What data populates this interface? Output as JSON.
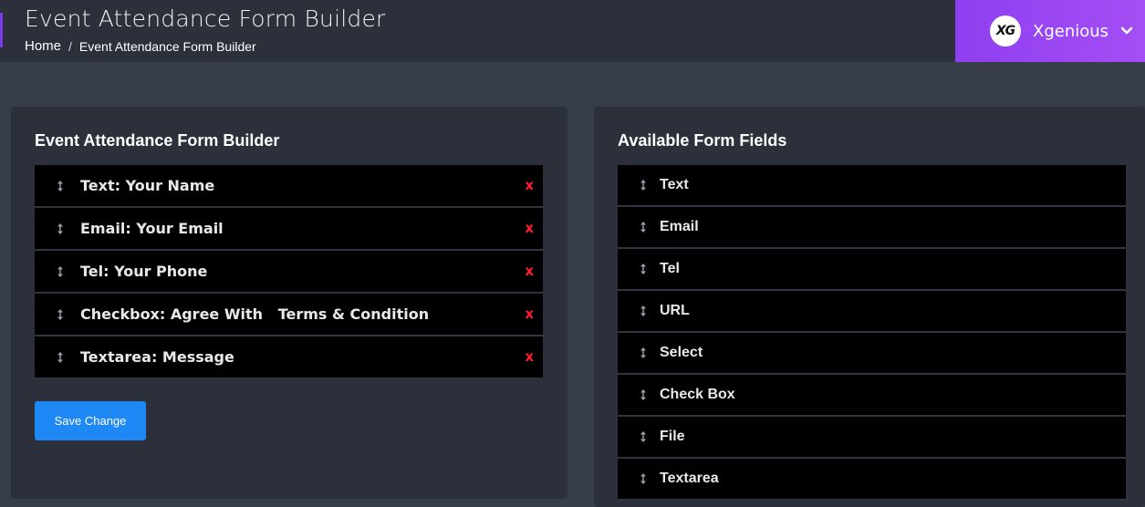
{
  "header": {
    "title": "Event Attendance Form Builder",
    "breadcrumb": {
      "home": "Home",
      "separator": "/",
      "current": "Event Attendance Form Builder"
    },
    "user": {
      "avatar_text": "XG",
      "name": "Xgenious"
    }
  },
  "builder": {
    "title": "Event Attendance Form Builder",
    "fields": [
      {
        "label": "Text: Your Name"
      },
      {
        "label": "Email: Your Email"
      },
      {
        "label": "Tel: Your Phone"
      },
      {
        "label": "Checkbox: Agree With   Terms & Condition"
      },
      {
        "label": "Textarea: Message"
      }
    ],
    "remove_label": "x",
    "save_label": "Save Change"
  },
  "available": {
    "title": "Available Form Fields",
    "fields": [
      {
        "label": "Text"
      },
      {
        "label": "Email"
      },
      {
        "label": "Tel"
      },
      {
        "label": "URL"
      },
      {
        "label": "Select"
      },
      {
        "label": "Check Box"
      },
      {
        "label": "File"
      },
      {
        "label": "Textarea"
      }
    ]
  },
  "colors": {
    "accent": "#8f3ff0",
    "button": "#1e88f5",
    "remove": "#ff1d2e"
  }
}
